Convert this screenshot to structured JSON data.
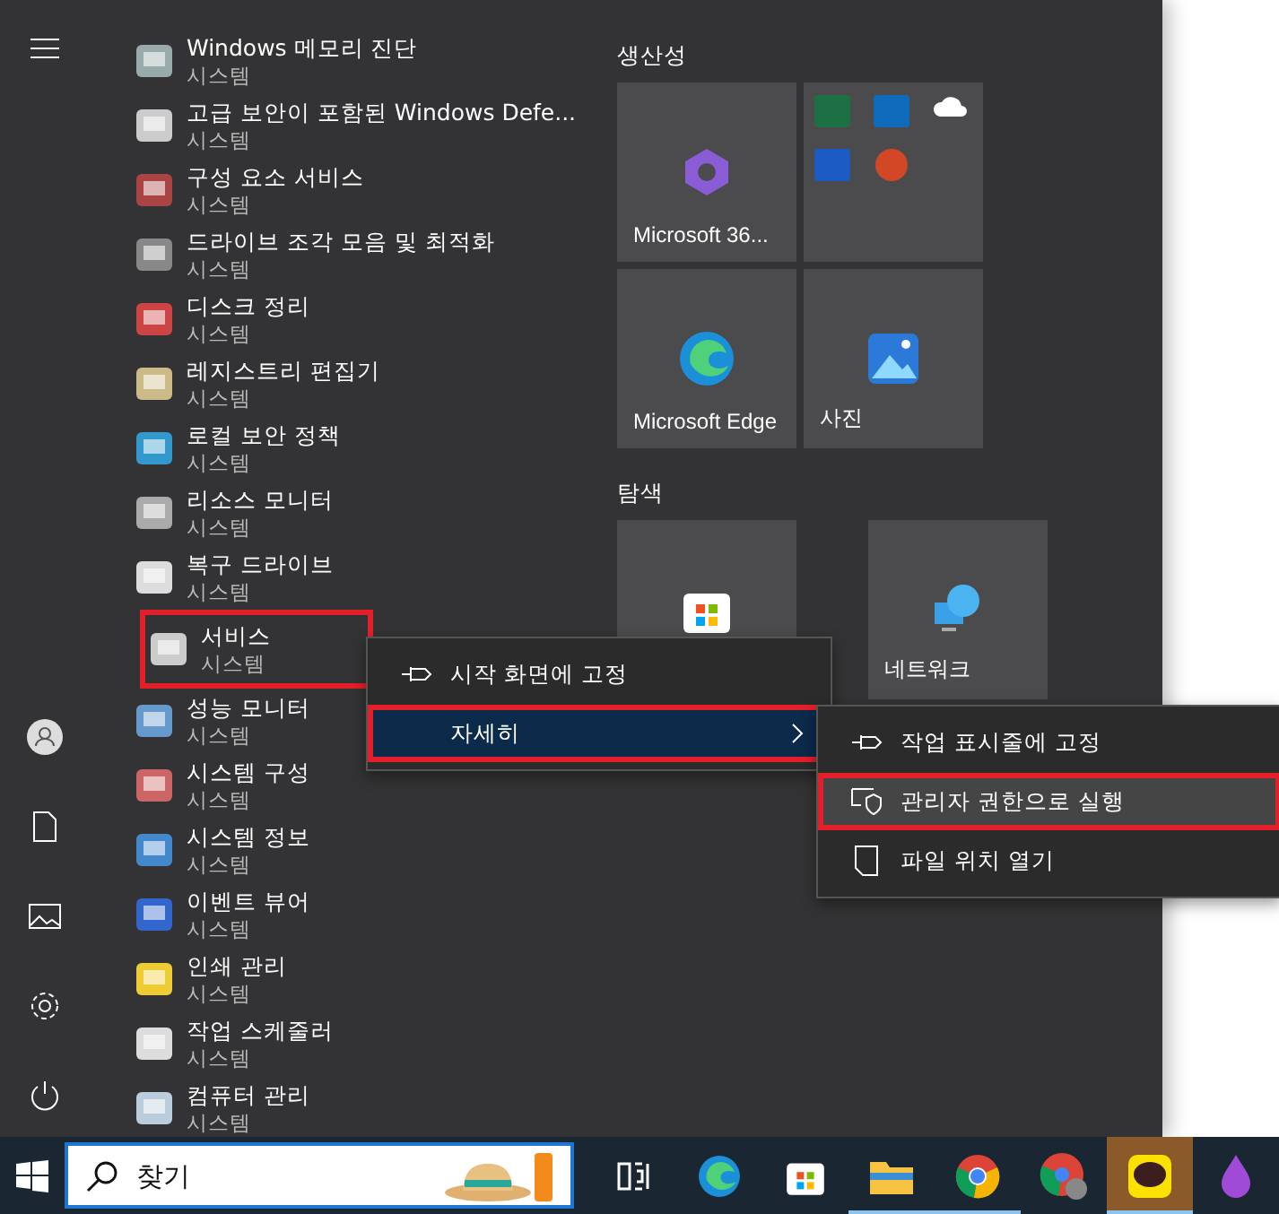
{
  "start_menu": {
    "apps": [
      {
        "kind": "full",
        "name": "Windows 메모리 진단",
        "subtitle": "시스템",
        "annotated": false
      },
      {
        "kind": "full",
        "name": "고급 보안이 포함된 Windows Defe...",
        "subtitle": "시스템",
        "annotated": false
      },
      {
        "kind": "full",
        "name": "구성 요소 서비스",
        "subtitle": "시스템",
        "annotated": false
      },
      {
        "kind": "full",
        "name": "드라이브 조각 모음 및 최적화",
        "subtitle": "시스템",
        "annotated": false
      },
      {
        "kind": "full",
        "name": "디스크 정리",
        "subtitle": "시스템",
        "annotated": false
      },
      {
        "kind": "full",
        "name": "레지스트리 편집기",
        "subtitle": "시스템",
        "annotated": false
      },
      {
        "kind": "full",
        "name": "로컬 보안 정책",
        "subtitle": "시스템",
        "annotated": false
      },
      {
        "kind": "full",
        "name": "리소스 모니터",
        "subtitle": "시스템",
        "annotated": false
      },
      {
        "kind": "full",
        "name": "복구 드라이브",
        "subtitle": "시스템",
        "annotated": false
      },
      {
        "kind": "full",
        "name": "서비스",
        "subtitle": "시스템",
        "annotated": true
      },
      {
        "kind": "full",
        "name": "성능 모니터",
        "subtitle": "시스템",
        "annotated": false
      },
      {
        "kind": "full",
        "name": "시스템 구성",
        "subtitle": "시스템",
        "annotated": false
      },
      {
        "kind": "full",
        "name": "시스템 정보",
        "subtitle": "시스템",
        "annotated": false
      },
      {
        "kind": "full",
        "name": "이벤트 뷰어",
        "subtitle": "시스템",
        "annotated": false
      },
      {
        "kind": "full",
        "name": "인쇄 관리",
        "subtitle": "시스템",
        "annotated": false
      },
      {
        "kind": "full",
        "name": "작업 스케줄러",
        "subtitle": "시스템",
        "annotated": false
      },
      {
        "kind": "full",
        "name": "컴퓨터 관리",
        "subtitle": "시스템",
        "annotated": false
      }
    ],
    "tile_groups": [
      {
        "title": "생산성",
        "tiles": [
          {
            "kind": "app",
            "label": "Microsoft 36..."
          },
          {
            "kind": "folder"
          },
          {
            "kind": "app",
            "label": "Microsoft Edge"
          },
          {
            "kind": "app",
            "label": "사진"
          }
        ]
      },
      {
        "title": "탐색",
        "tiles": [
          {
            "kind": "app"
          },
          {
            "kind": "app",
            "label": "네트워크"
          }
        ]
      }
    ],
    "context_menu": {
      "items": [
        {
          "label": "시작 화면에 고정",
          "selected": false,
          "annotated": false,
          "has_submenu": false
        },
        {
          "label": "자세히",
          "selected": true,
          "annotated": true,
          "has_submenu": true
        }
      ]
    },
    "submenu": {
      "items": [
        {
          "label": "작업 표시줄에 고정",
          "selected": false,
          "annotated": false
        },
        {
          "label": "관리자 권한으로 실행",
          "selected": true,
          "annotated": true
        },
        {
          "label": "파일 위치 열기",
          "selected": false,
          "annotated": false
        }
      ]
    }
  },
  "taskbar": {
    "search": {
      "placeholder": "찾기"
    },
    "apps": [
      {
        "running": false,
        "highlighted": false
      },
      {
        "running": false,
        "highlighted": false
      },
      {
        "running": false,
        "highlighted": false
      },
      {
        "running": true,
        "highlighted": false
      },
      {
        "running": true,
        "highlighted": false
      },
      {
        "running": false,
        "highlighted": false
      },
      {
        "running": true,
        "highlighted": true
      },
      {
        "running": false,
        "highlighted": false
      }
    ]
  }
}
